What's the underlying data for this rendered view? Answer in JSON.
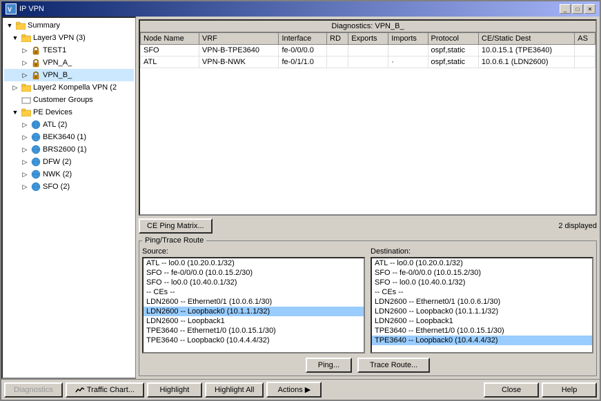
{
  "window": {
    "title": "IP VPN",
    "titlebar_buttons": [
      "minimize",
      "maximize",
      "close"
    ]
  },
  "tree": {
    "items": [
      {
        "id": "summary",
        "label": "Summary",
        "level": 0,
        "expanded": true,
        "type": "folder"
      },
      {
        "id": "layer3vpn",
        "label": "Layer3 VPN (3)",
        "level": 1,
        "expanded": true,
        "type": "folder"
      },
      {
        "id": "test1",
        "label": "TEST1",
        "level": 2,
        "expanded": false,
        "type": "lock"
      },
      {
        "id": "vpn_a",
        "label": "VPN_A_",
        "level": 2,
        "expanded": false,
        "type": "lock"
      },
      {
        "id": "vpn_b",
        "label": "VPN_B_",
        "level": 2,
        "expanded": false,
        "type": "lock"
      },
      {
        "id": "layer2kompella",
        "label": "Layer2 Kompella VPN (2",
        "level": 1,
        "expanded": false,
        "type": "folder"
      },
      {
        "id": "customergroups",
        "label": "Customer Groups",
        "level": 1,
        "expanded": false,
        "type": "group"
      },
      {
        "id": "pedevices",
        "label": "PE Devices",
        "level": 1,
        "expanded": true,
        "type": "folder"
      },
      {
        "id": "atl",
        "label": "ATL (2)",
        "level": 2,
        "expanded": false,
        "type": "globe"
      },
      {
        "id": "bek3640",
        "label": "BEK3640 (1)",
        "level": 2,
        "expanded": false,
        "type": "globe"
      },
      {
        "id": "brs2600",
        "label": "BRS2600 (1)",
        "level": 2,
        "expanded": false,
        "type": "globe"
      },
      {
        "id": "dfw",
        "label": "DFW (2)",
        "level": 2,
        "expanded": false,
        "type": "globe"
      },
      {
        "id": "nwk",
        "label": "NWK (2)",
        "level": 2,
        "expanded": false,
        "type": "globe"
      },
      {
        "id": "sfo",
        "label": "SFO (2)",
        "level": 2,
        "expanded": false,
        "type": "globe"
      }
    ]
  },
  "diagnostics": {
    "title": "Diagnostics: VPN_B_",
    "columns": [
      "Node Name",
      "VRF",
      "Interface",
      "RD",
      "Exports",
      "Imports",
      "Protocol",
      "CE/Static Dest",
      "AS"
    ],
    "rows": [
      {
        "node": "SFO",
        "vrf": "VPN-B-TPE3640",
        "interface": "fe-0/0/0.0",
        "rd": "",
        "exports": "",
        "imports": "",
        "protocol": "ospf,static",
        "cedest": "10.0.15.1 (TPE3640)",
        "as": ""
      },
      {
        "node": "ATL",
        "vrf": "VPN-B-NWK",
        "interface": "fe-0/1/1.0",
        "rd": "",
        "exports": "",
        "imports": "·",
        "protocol": "ospf,static",
        "cedest": "10.0.6.1 (LDN2600)",
        "as": ""
      }
    ],
    "count": "2 displayed"
  },
  "ce_ping_button": "CE Ping Matrix...",
  "ping_trace": {
    "title": "Ping/Trace Route",
    "source_label": "Source:",
    "destination_label": "Destination:",
    "source_items": [
      "ATL -- lo0.0 (10.20.0.1/32)",
      "SFO -- fe-0/0/0.0 (10.0.15.2/30)",
      "SFO -- lo0.0 (10.40.0.1/32)",
      "-- CEs --",
      "LDN2600 -- Ethernet0/1 (10.0.6.1/30)",
      "LDN2600 -- Loopback0 (10.1.1.1/32)",
      "LDN2600 -- Loopback1",
      "TPE3640 -- Ethernet1/0 (10.0.15.1/30)",
      "TPE3640 -- Loopback0 (10.4.4.4/32)"
    ],
    "dest_items": [
      "ATL -- lo0.0 (10.20.0.1/32)",
      "SFO -- fe-0/0/0.0 (10.0.15.2/30)",
      "SFO -- lo0.0 (10.40.0.1/32)",
      "-- CEs --",
      "LDN2600 -- Ethernet0/1 (10.0.6.1/30)",
      "LDN2600 -- Loopback0 (10.1.1.1/32)",
      "LDN2600 -- Loopback1",
      "TPE3640 -- Ethernet1/0 (10.0.15.1/30)",
      "TPE3640 -- Loopback0 (10.4.4.4/32)"
    ],
    "selected_source_index": 5,
    "selected_dest_index": 8,
    "ping_button": "Ping...",
    "trace_button": "Trace Route..."
  },
  "status_bar": {
    "diagnostics_btn": "Diagnostics",
    "traffic_chart_btn": "Traffic Chart...",
    "highlight_btn": "Highlight",
    "highlight_all_btn": "Highlight All",
    "actions_btn": "Actions ▶",
    "close_btn": "Close",
    "help_btn": "Help"
  }
}
